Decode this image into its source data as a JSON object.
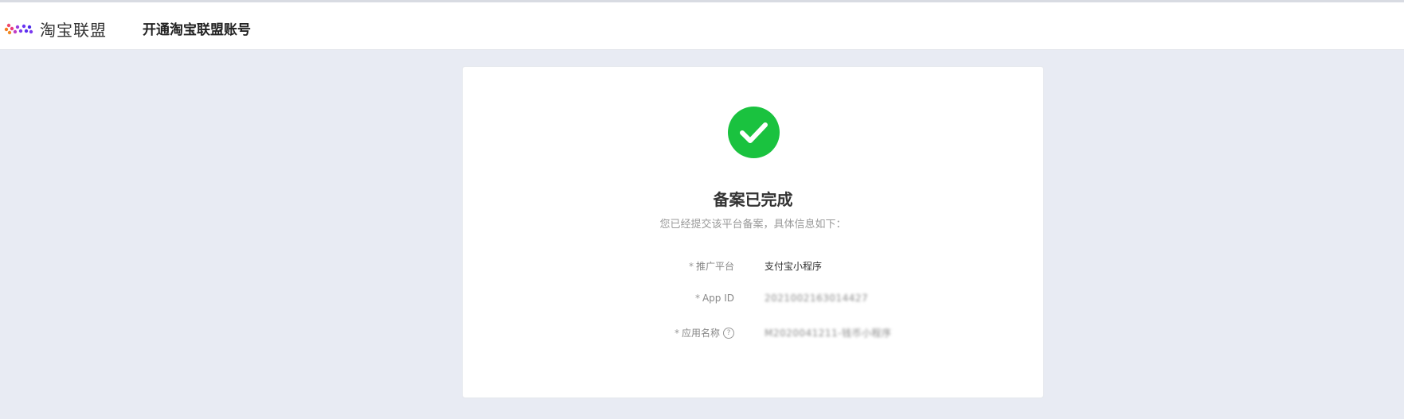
{
  "header": {
    "brand": "淘宝联盟",
    "title": "开通淘宝联盟账号",
    "logo_icon": "taobao-union-dots-logo"
  },
  "result": {
    "icon": "check-circle-icon",
    "icon_color": "#1ac23f",
    "title": "备案已完成",
    "subtitle": "您已经提交该平台备案，具体信息如下："
  },
  "fields": [
    {
      "label": "推广平台",
      "value": "支付宝小程序",
      "required": "*"
    },
    {
      "label": "App ID",
      "value": "2021002163014427",
      "required": "*"
    },
    {
      "label": "应用名称",
      "value": "M2020041211-钱币小程序",
      "required": "*",
      "help_icon": "question-circle-icon"
    }
  ]
}
